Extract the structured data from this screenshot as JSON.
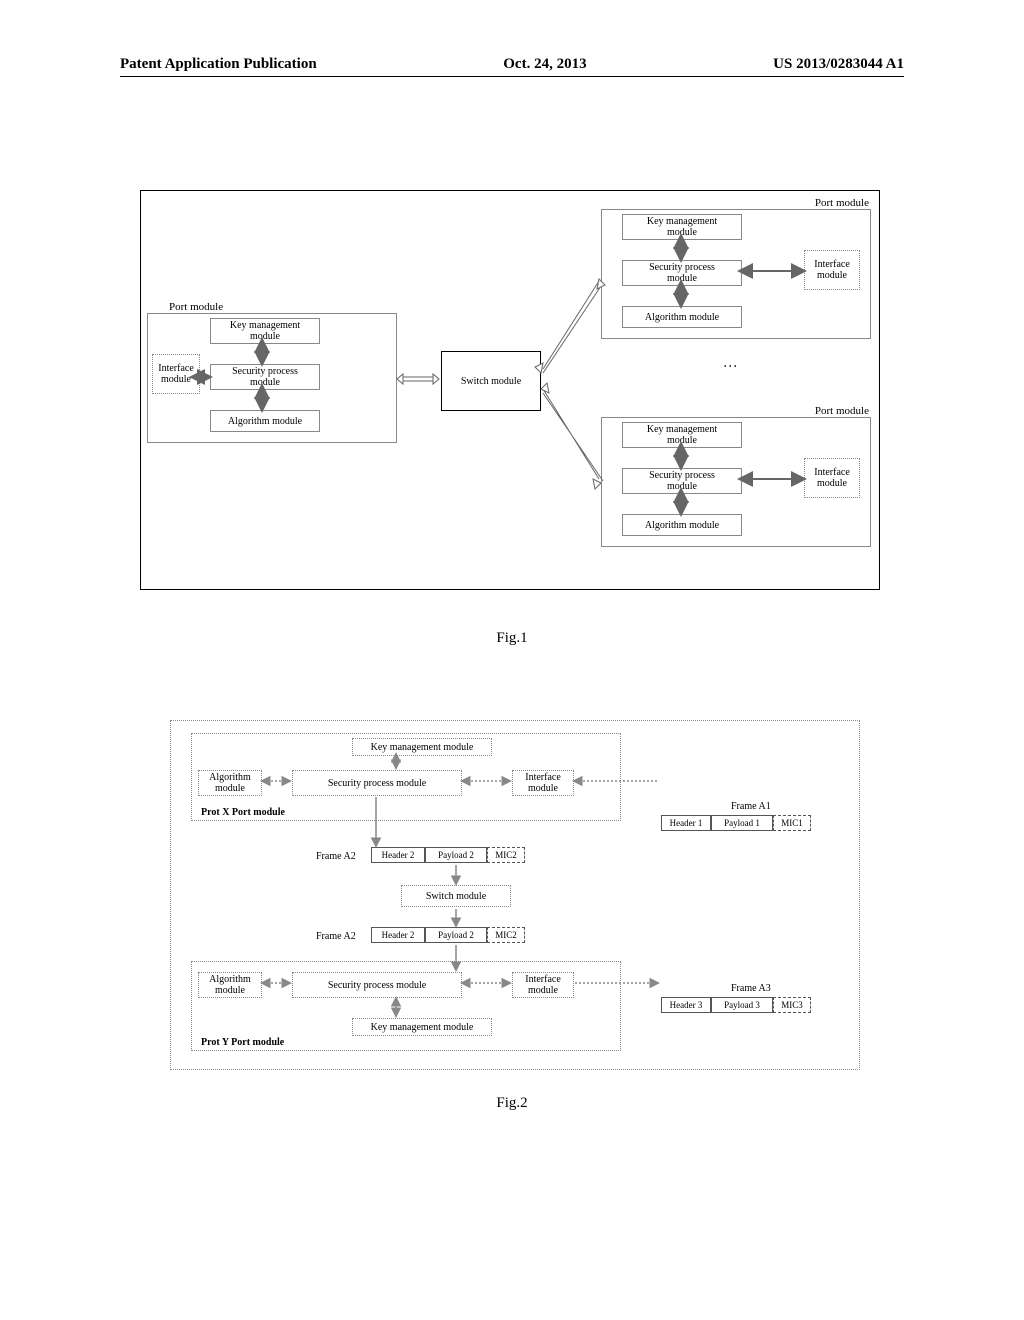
{
  "header": {
    "left": "Patent Application Publication",
    "center": "Oct. 24, 2013",
    "right": "US 2013/0283044 A1"
  },
  "fig1": {
    "caption": "Fig.1",
    "port_label": "Port module",
    "interface": "Interface\nmodule",
    "key_mgmt": "Key management\nmodule",
    "security": "Security process\nmodule",
    "algorithm": "Algorithm module",
    "switch": "Switch module"
  },
  "fig2": {
    "caption": "Fig.2",
    "key_mgmt": "Key management module",
    "algorithm": "Algorithm\nmodule",
    "security": "Security process module",
    "interface": "Interface\nmodule",
    "portx": "Prot X Port module",
    "porty": "Prot Y Port module",
    "switch": "Switch module",
    "frame_a1": "Frame A1",
    "frame_a2": "Frame A2",
    "frame_a3": "Frame A3",
    "header_n": "Header",
    "payload_n": "Payload",
    "mic_n": "MIC"
  }
}
